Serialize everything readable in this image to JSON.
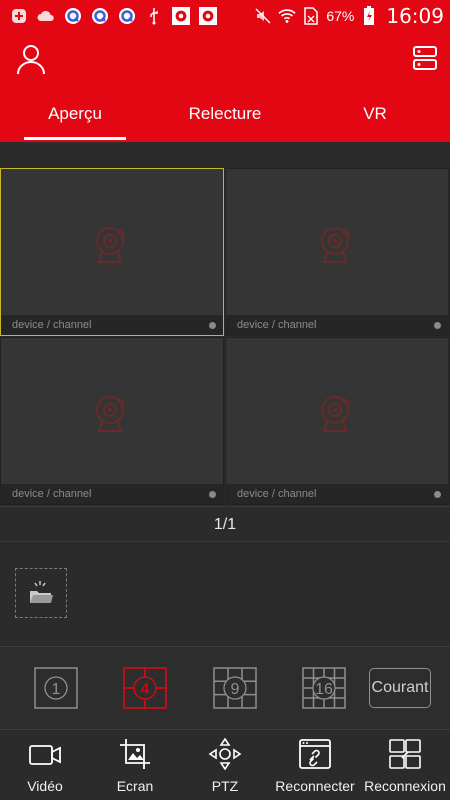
{
  "status_bar": {
    "battery": "67%",
    "time": "16:09",
    "icons": [
      "notification-plus-icon",
      "cloud-icon",
      "browser-q-icon",
      "browser-q-icon",
      "browser-q-icon",
      "usb-icon",
      "camera-app-icon",
      "camera-app-icon",
      "mute-icon",
      "wifi-icon",
      "no-sim-icon",
      "battery-charging-icon"
    ]
  },
  "header": {
    "user_icon": "user-icon",
    "device_icon": "device-list-icon",
    "accent_color": "#e30613"
  },
  "tabs": [
    {
      "label": "Aperçu",
      "active": true
    },
    {
      "label": "Relecture",
      "active": false
    },
    {
      "label": "VR",
      "active": false
    }
  ],
  "preview": {
    "cells": [
      {
        "caption": "device / channel",
        "selected": true
      },
      {
        "caption": "device / channel",
        "selected": false
      },
      {
        "caption": "device / channel",
        "selected": false
      },
      {
        "caption": "device / channel",
        "selected": false
      }
    ],
    "pager": "1/1"
  },
  "layouts": [
    {
      "label": "1",
      "active": false
    },
    {
      "label": "4",
      "active": true
    },
    {
      "label": "9",
      "active": false
    },
    {
      "label": "16",
      "active": false
    }
  ],
  "courant_label": "Courant",
  "toolbar": [
    {
      "label": "Vidéo",
      "icon": "video-camera-icon"
    },
    {
      "label": "Ecran",
      "icon": "screenshot-icon"
    },
    {
      "label": "PTZ",
      "icon": "ptz-icon"
    },
    {
      "label": "Reconnecter",
      "icon": "reconnect-icon"
    },
    {
      "label": "Reconnexion",
      "icon": "reconnect-all-icon"
    }
  ]
}
